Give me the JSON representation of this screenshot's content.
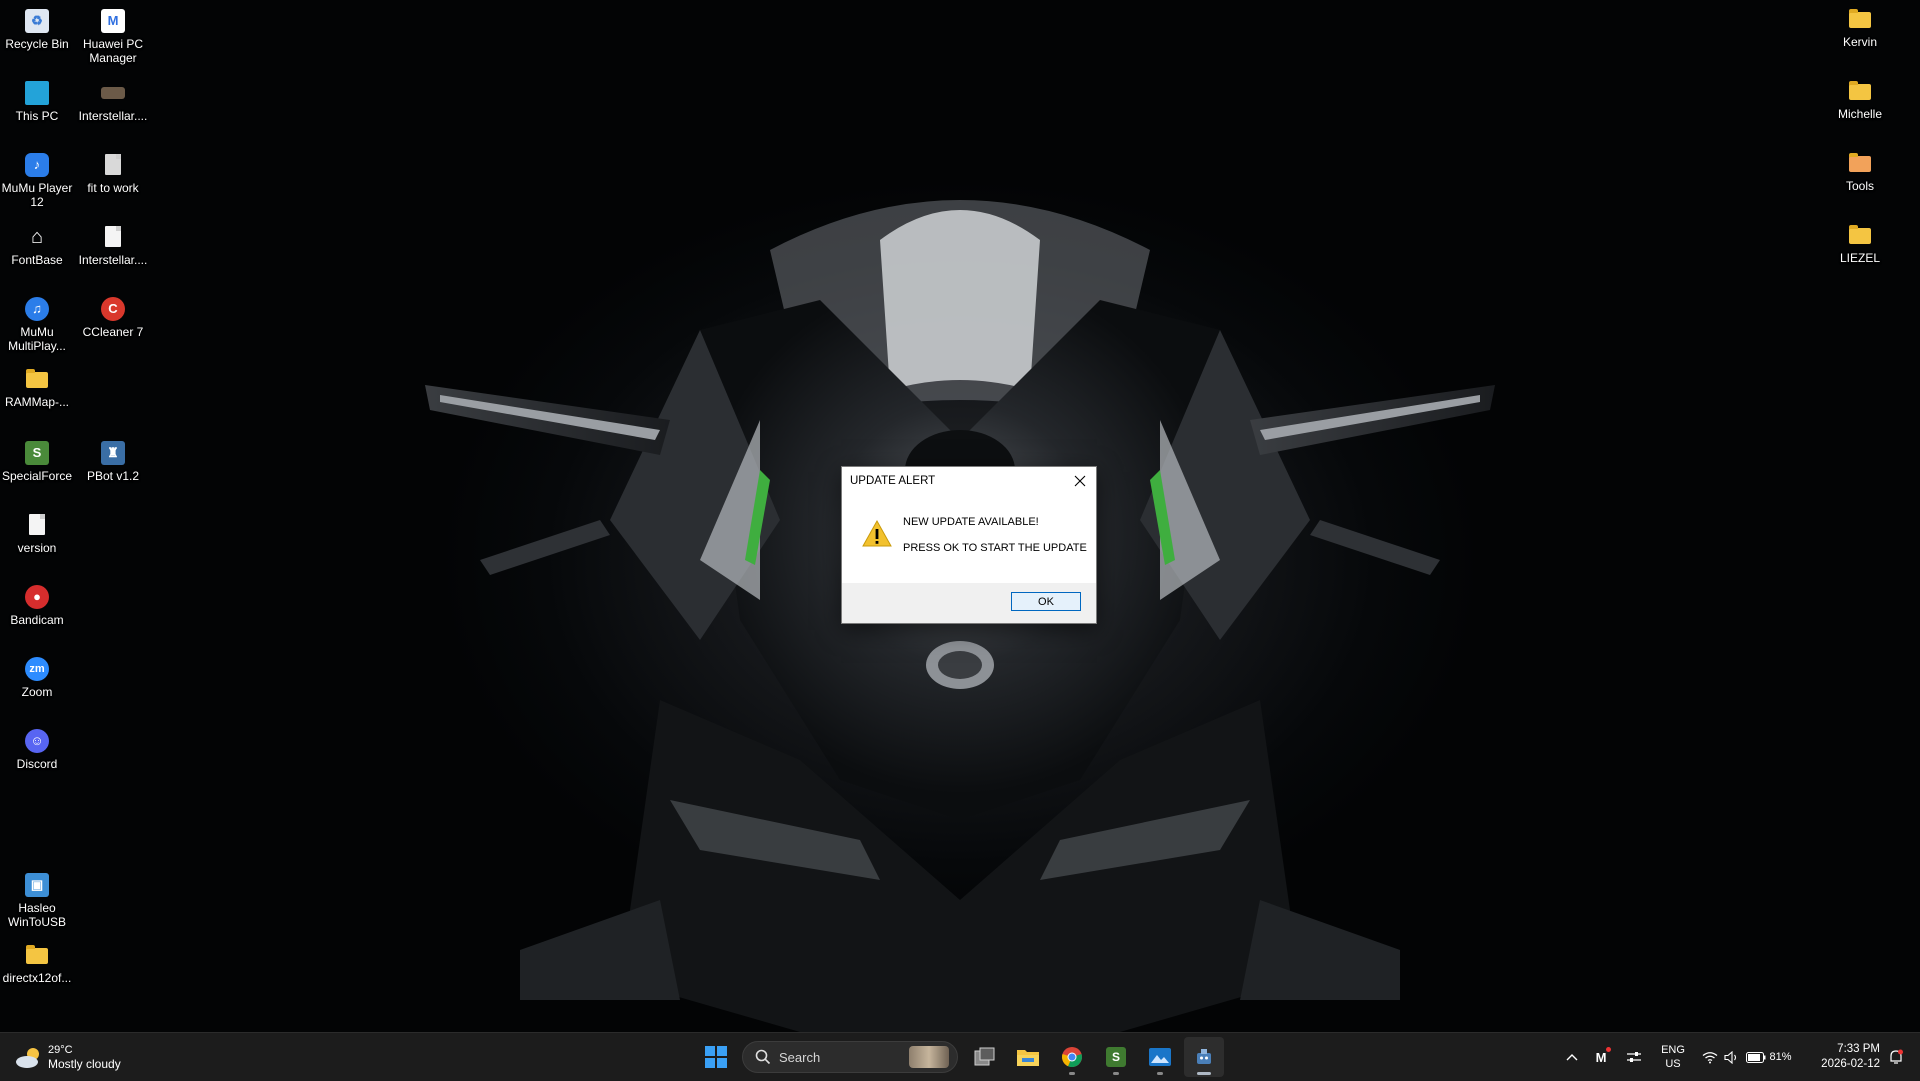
{
  "desktop": {
    "icons_left": [
      {
        "label": "Recycle Bin",
        "icon": "recycle-bin-icon",
        "color": "#3a7bd5"
      },
      {
        "label": "Huawei PC Manager",
        "icon": "huawei-pc-manager-icon",
        "color": "#2f6fe0"
      },
      {
        "label": "This PC",
        "icon": "computer-monitor-icon",
        "color": "#23a3d9"
      },
      {
        "label": "Interstellar....",
        "icon": "video-thumbnail-icon",
        "color": "#6b5a48"
      },
      {
        "label": "MuMu Player 12",
        "icon": "mumu-player-icon",
        "color": "#2b7de9"
      },
      {
        "label": "fit to work",
        "icon": "document-icon",
        "color": "#d9d9d9"
      },
      {
        "label": "FontBase",
        "icon": "fontbase-icon",
        "color": "#ffffff"
      },
      {
        "label": "Interstellar....",
        "icon": "document-icon",
        "color": "#f4f4f4"
      },
      {
        "label": "MuMu MultiPlay...",
        "icon": "mumu-multiplayer-icon",
        "color": "#2b7de9"
      },
      {
        "label": "CCleaner 7",
        "icon": "ccleaner-icon",
        "color": "#d9382c"
      },
      {
        "label": "RAMMap-...",
        "icon": "folder-icon",
        "color": "#f4c542"
      },
      {
        "label": "SpecialForce",
        "icon": "specialforce-game-icon",
        "color": "#4a8a3a"
      },
      {
        "label": "PBot v1.2",
        "icon": "pbot-robot-icon",
        "color": "#3a6ea5"
      },
      {
        "label": "version",
        "icon": "document-icon",
        "color": "#f4f4f4"
      },
      {
        "label": "Bandicam",
        "icon": "bandicam-icon",
        "color": "#d62d2d"
      },
      {
        "label": "Zoom",
        "icon": "zoom-icon",
        "color": "#2d8cff"
      },
      {
        "label": "Discord",
        "icon": "discord-icon",
        "color": "#5865f2"
      },
      {
        "label": "Hasleo WinToUSB",
        "icon": "hasleo-wintousb-icon",
        "color": "#3d8fd6"
      },
      {
        "label": "directx12of...",
        "icon": "folder-icon",
        "color": "#f4c542"
      }
    ],
    "icons_right": [
      {
        "label": "Kervin",
        "icon": "folder-icon"
      },
      {
        "label": "Michelle",
        "icon": "folder-icon"
      },
      {
        "label": "Tools",
        "icon": "folder-icon"
      },
      {
        "label": "LIEZEL",
        "icon": "folder-icon"
      }
    ]
  },
  "dialog": {
    "title": "UPDATE ALERT",
    "message_line1": "NEW UPDATE AVAILABLE!",
    "message_line2": "PRESS OK TO START THE UPDATE",
    "ok_label": "OK",
    "icon": "warning-triangle-icon"
  },
  "taskbar": {
    "weather": {
      "temp": "29°C",
      "condition": "Mostly cloudy",
      "icon": "partly-cloudy-icon"
    },
    "search_placeholder": "Search",
    "pinned": [
      "windows-start-icon",
      "task-view-icon",
      "file-explorer-icon",
      "chrome-icon",
      "specialforce-game-icon",
      "photos-icon",
      "pbot-robot-icon"
    ],
    "tray": {
      "lang_line1": "ENG",
      "lang_line2": "US",
      "battery": "81%",
      "time": "7:33 PM",
      "date": "2026-02-12"
    }
  },
  "colors": {
    "accent": "#0067c0",
    "taskbar_bg": "#1c1c1c",
    "warning_yellow": "#f2c12e"
  }
}
